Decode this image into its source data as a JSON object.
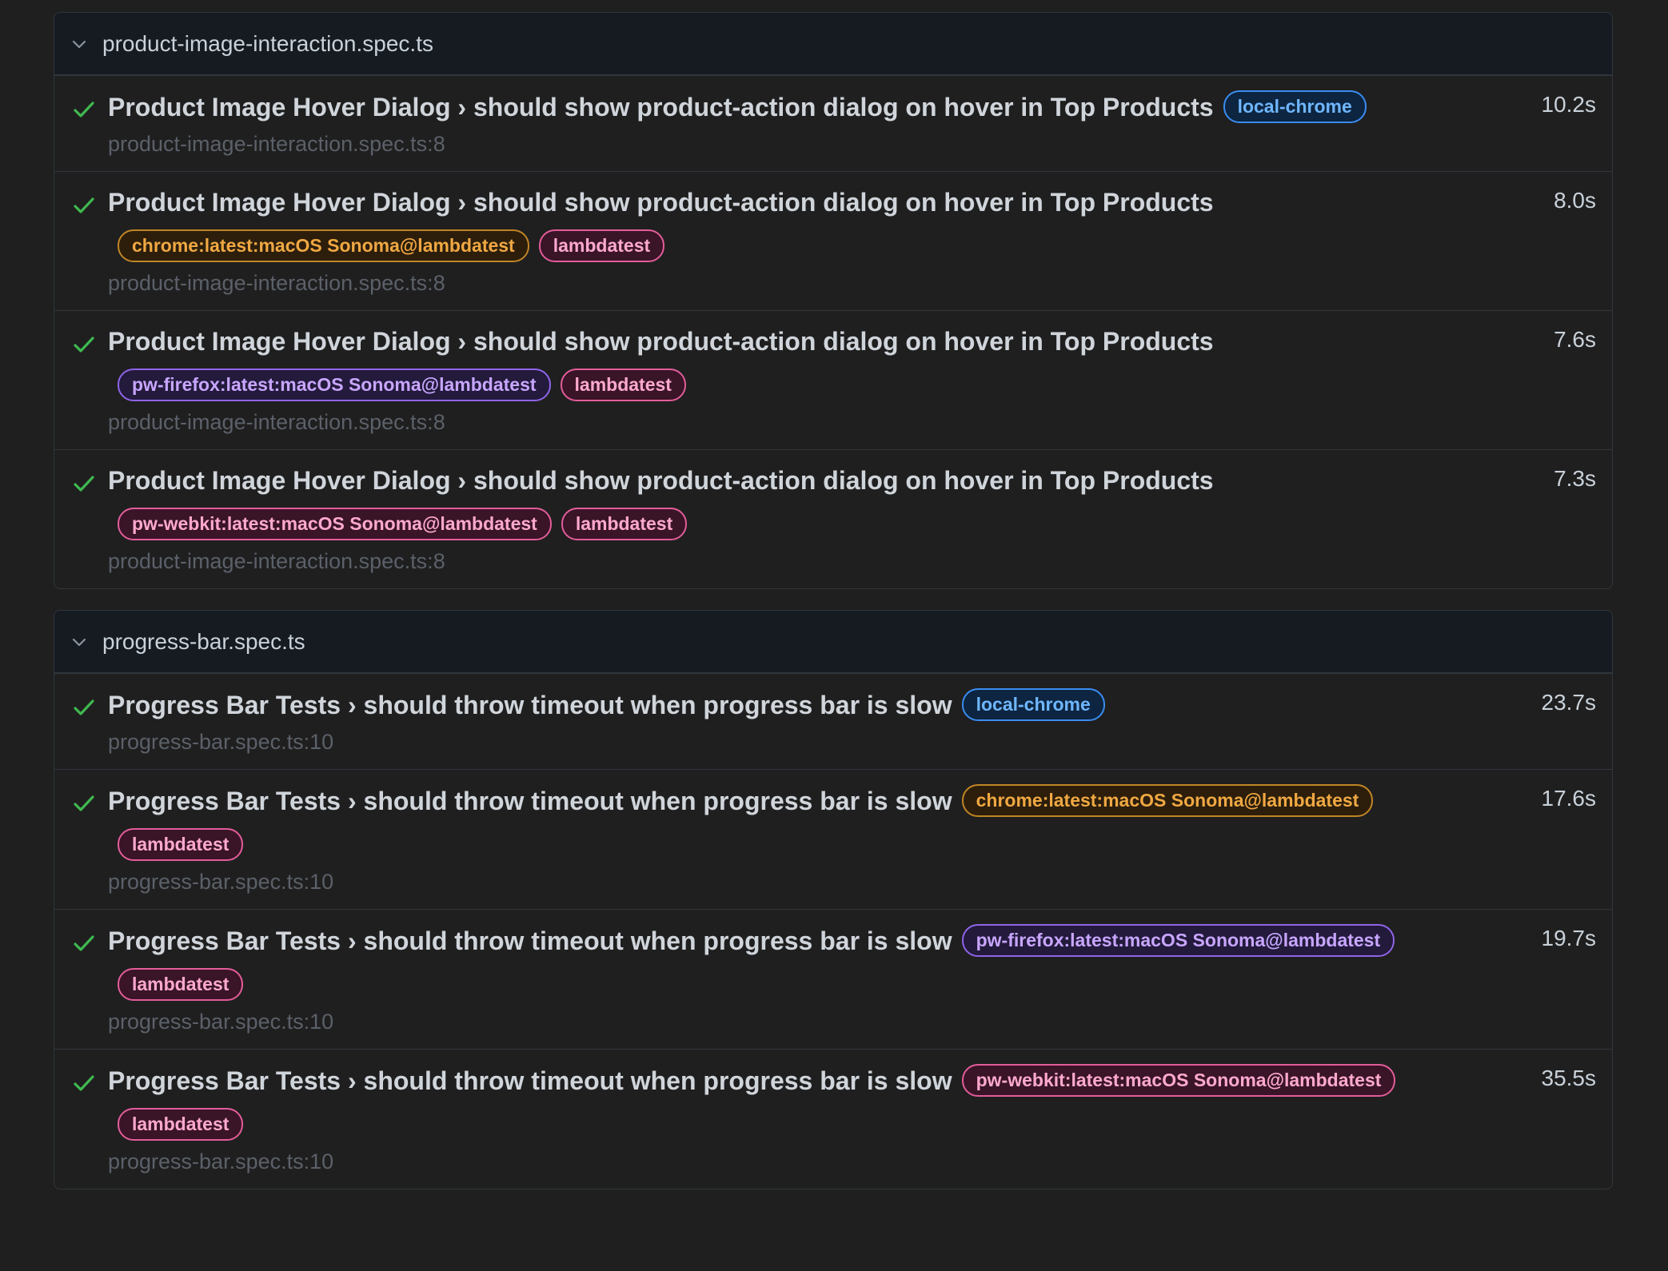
{
  "files": [
    {
      "name": "product-image-interaction.spec.ts",
      "tests": [
        {
          "title": "Product Image Hover Dialog › should show product-action dialog on hover in Top Products",
          "inline_tags": [
            {
              "label": "local-chrome",
              "color": "blue"
            }
          ],
          "tags": [],
          "duration": "10.2s",
          "location": "product-image-interaction.spec.ts:8"
        },
        {
          "title": "Product Image Hover Dialog › should show product-action dialog on hover in Top Products",
          "inline_tags": [],
          "tags": [
            {
              "label": "chrome:latest:macOS Sonoma@lambdatest",
              "color": "orange"
            },
            {
              "label": "lambdatest",
              "color": "pink"
            }
          ],
          "duration": "8.0s",
          "location": "product-image-interaction.spec.ts:8"
        },
        {
          "title": "Product Image Hover Dialog › should show product-action dialog on hover in Top Products",
          "inline_tags": [],
          "tags": [
            {
              "label": "pw-firefox:latest:macOS Sonoma@lambdatest",
              "color": "purple"
            },
            {
              "label": "lambdatest",
              "color": "pink"
            }
          ],
          "duration": "7.6s",
          "location": "product-image-interaction.spec.ts:8"
        },
        {
          "title": "Product Image Hover Dialog › should show product-action dialog on hover in Top Products",
          "inline_tags": [],
          "tags": [
            {
              "label": "pw-webkit:latest:macOS Sonoma@lambdatest",
              "color": "pink"
            },
            {
              "label": "lambdatest",
              "color": "pink"
            }
          ],
          "duration": "7.3s",
          "location": "product-image-interaction.spec.ts:8"
        }
      ]
    },
    {
      "name": "progress-bar.spec.ts",
      "tests": [
        {
          "title": "Progress Bar Tests › should throw timeout when progress bar is slow",
          "inline_tags": [
            {
              "label": "local-chrome",
              "color": "blue"
            }
          ],
          "tags": [],
          "duration": "23.7s",
          "location": "progress-bar.spec.ts:10"
        },
        {
          "title": "Progress Bar Tests › should throw timeout when progress bar is slow",
          "inline_tags": [
            {
              "label": "chrome:latest:macOS Sonoma@lambdatest",
              "color": "orange"
            }
          ],
          "tags": [
            {
              "label": "lambdatest",
              "color": "pink"
            }
          ],
          "duration": "17.6s",
          "location": "progress-bar.spec.ts:10"
        },
        {
          "title": "Progress Bar Tests › should throw timeout when progress bar is slow",
          "inline_tags": [
            {
              "label": "pw-firefox:latest:macOS Sonoma@lambdatest",
              "color": "purple"
            }
          ],
          "tags": [
            {
              "label": "lambdatest",
              "color": "pink"
            }
          ],
          "duration": "19.7s",
          "location": "progress-bar.spec.ts:10"
        },
        {
          "title": "Progress Bar Tests › should throw timeout when progress bar is slow",
          "inline_tags": [
            {
              "label": "pw-webkit:latest:macOS Sonoma@lambdatest",
              "color": "pink"
            }
          ],
          "tags": [
            {
              "label": "lambdatest",
              "color": "pink"
            }
          ],
          "duration": "35.5s",
          "location": "progress-bar.spec.ts:10"
        }
      ]
    }
  ],
  "icons": {
    "expand": "chevron-down-icon",
    "status": "check-icon"
  },
  "colors": {
    "pass": "#3fb950",
    "background": "#1f1f1f",
    "header": "#161b22",
    "border": "#30363d"
  }
}
